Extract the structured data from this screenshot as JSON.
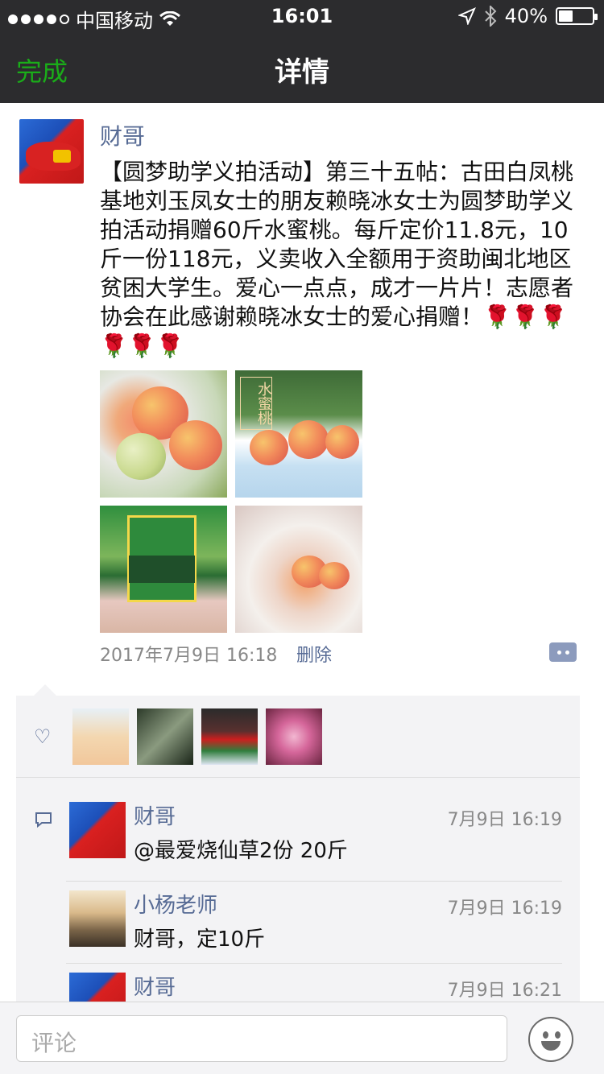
{
  "status_bar": {
    "carrier": "中国移动",
    "time": "16:01",
    "battery": "40%",
    "battery_level": 0.4
  },
  "nav": {
    "back_label": "完成",
    "title": "详情"
  },
  "post": {
    "author": "财哥",
    "text": "【圆梦助学义拍活动】第三十五帖：古田白凤桃基地刘玉凤女士的朋友赖晓冰女士为圆梦助学义拍活动捐赠60斤水蜜桃。每斤定价11.8元，10斤一份118元，义卖收入全额用于资助闽北地区贫困大学生。爱心一点点，成才一片片！志愿者协会在此感谢赖晓冰女士的爱心捐赠！🌹🌹🌹🌹🌹🌹",
    "image_overlay_text": "水蜜桃",
    "time": "2017年7月9日 16:18",
    "delete_label": "删除"
  },
  "comments": [
    {
      "author": "财哥",
      "time": "7月9日 16:19",
      "text": "@最爱烧仙草2份 20斤"
    },
    {
      "author": "小杨老师",
      "time": "7月9日 16:19",
      "text": "财哥，定10斤"
    },
    {
      "author": "财哥",
      "time": "7月9日 16:21",
      "text": ""
    }
  ],
  "input": {
    "placeholder": "评论"
  },
  "colors": {
    "header_bg": "#2c2c2e",
    "accent_green": "#1aad19",
    "link_blue": "#576b95",
    "comment_bg": "#f3f3f5"
  }
}
